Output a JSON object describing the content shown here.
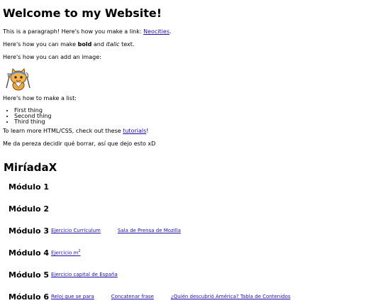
{
  "page": {
    "title": "Welcome to my Website!",
    "p1_text": "This is a paragraph! Here's how you make a link: ",
    "p1_link": "Neocities",
    "p1_end": ".",
    "p2_a": "Here's how you can make ",
    "p2_bold": "bold",
    "p2_b": " and ",
    "p2_italic": "italic",
    "p2_c": " text.",
    "p3": "Here's how you can add an image:",
    "image_icon": "neocities-cat-mascot",
    "p4": "Here's how to make a list:",
    "list": [
      "First thing",
      "Second thing",
      "Third thing"
    ],
    "p5_text": "To learn more HTML/CSS, check out these ",
    "p5_link": "tutorials",
    "p5_end": "!",
    "p6": "Me da pereza decidir qué borrar, así que dejo esto xD"
  },
  "miriadax": {
    "heading": "MiríadaX",
    "modules": [
      {
        "title": "Módulo 1",
        "links": []
      },
      {
        "title": "Módulo 2",
        "links": []
      },
      {
        "title": "Módulo 3",
        "links": [
          "Ejercicio Currículum",
          "Sala de Prensa de Mozilla"
        ]
      },
      {
        "title": "Módulo 4",
        "links": [
          "Ejercicio m"
        ]
      },
      {
        "title": "Módulo 5",
        "links": [
          "Ejercicio capital de España"
        ]
      },
      {
        "title": "Módulo 6",
        "links": [
          "Reloj que se para",
          "Concatenar frase",
          "¿Quién descubrió América? Tabla de Contenidos"
        ]
      }
    ],
    "m4_sup": "2"
  }
}
